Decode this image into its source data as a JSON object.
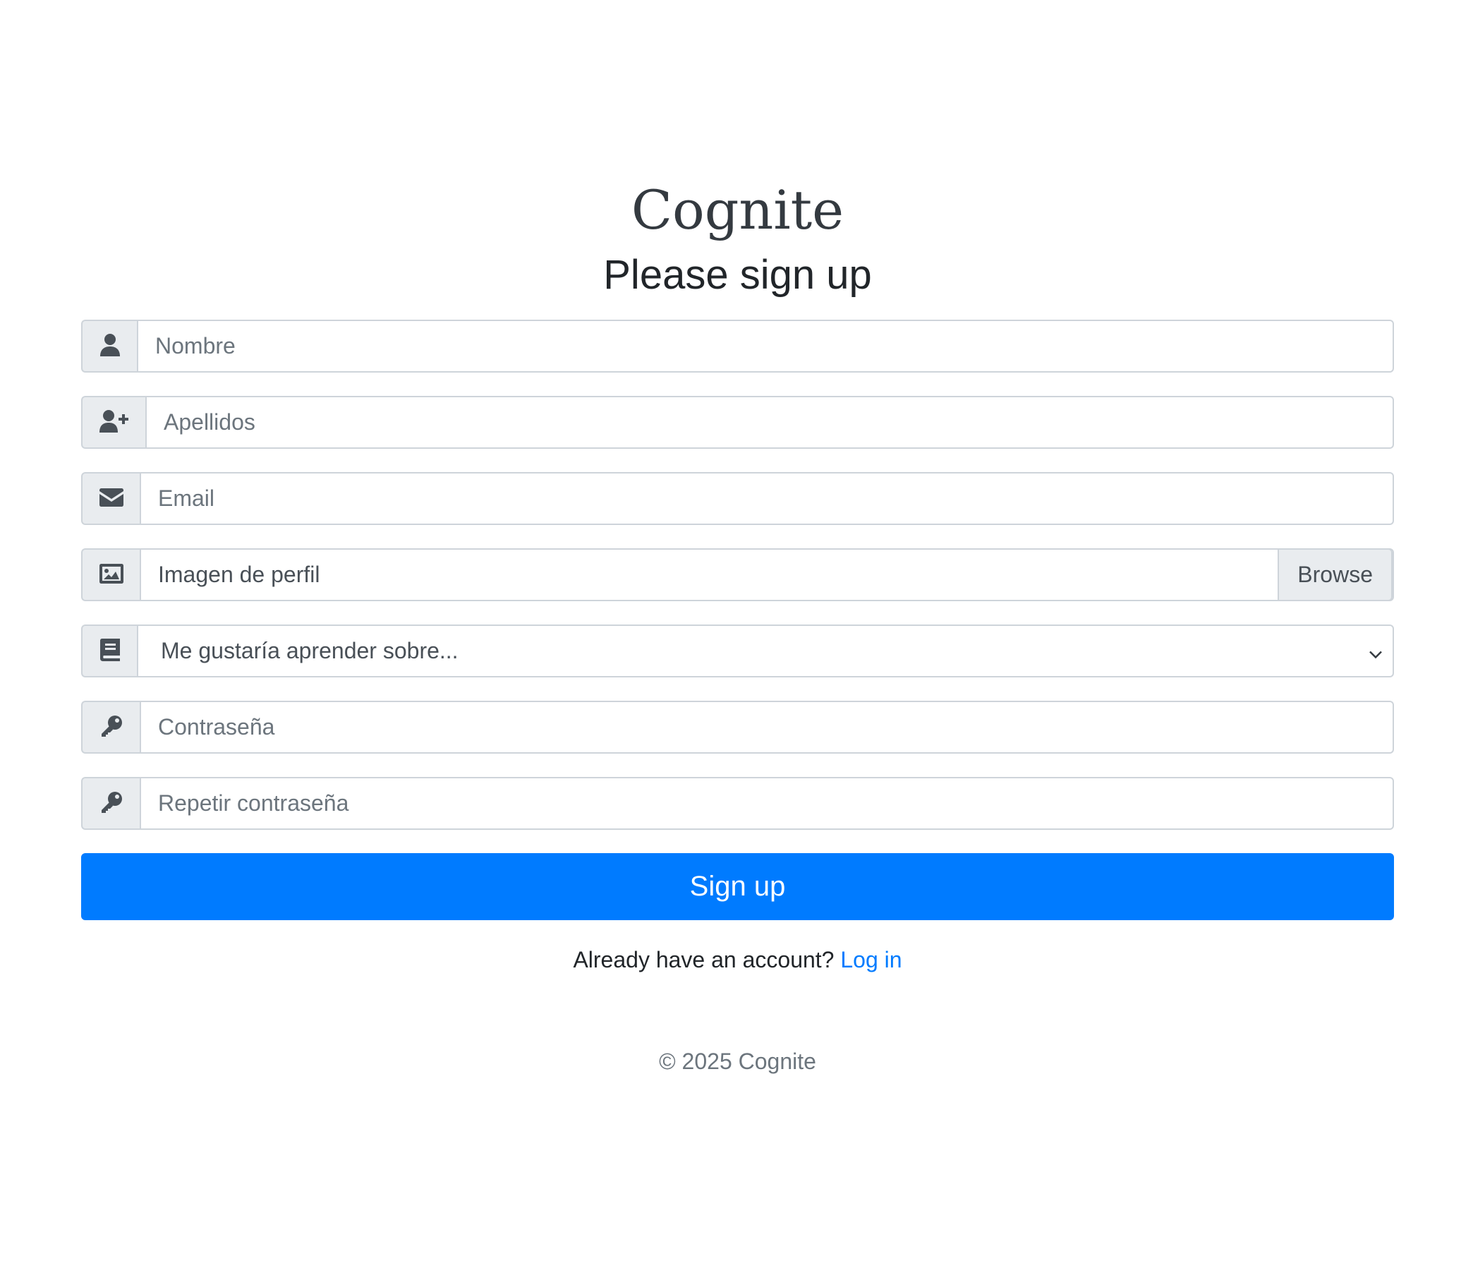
{
  "brand": "Cognite",
  "subtitle": "Please sign up",
  "form": {
    "nombre_placeholder": "Nombre",
    "apellidos_placeholder": "Apellidos",
    "email_placeholder": "Email",
    "imagen_label": "Imagen de perfil",
    "browse_label": "Browse",
    "topic_selected": "Me gustaría aprender sobre...",
    "password_placeholder": "Contraseña",
    "repeat_password_placeholder": "Repetir contraseña",
    "submit_label": "Sign up"
  },
  "account": {
    "prompt": "Already have an account?",
    "login_link": "Log in"
  },
  "footer": "© 2025 Cognite",
  "icons": {
    "nombre": "user-icon",
    "apellidos": "user-plus-icon",
    "email": "envelope-icon",
    "imagen": "image-icon",
    "topic": "book-icon",
    "password": "key-icon",
    "repeat_password": "key-icon"
  },
  "colors": {
    "primary": "#007bff",
    "addon_bg": "#e9ecef",
    "border": "#ced4da"
  }
}
